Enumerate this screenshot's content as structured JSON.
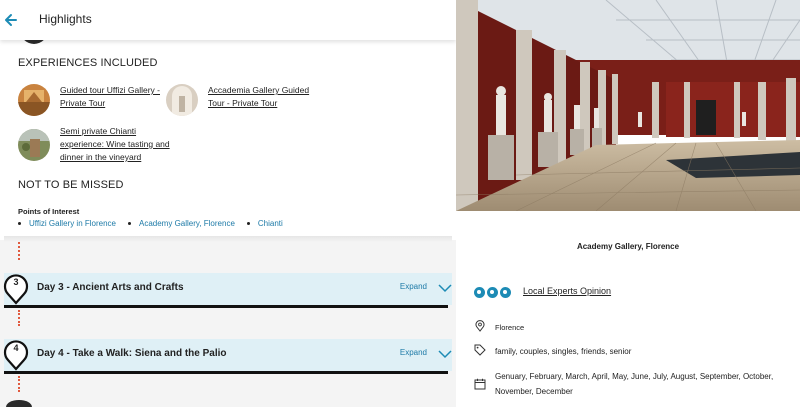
{
  "header": {
    "title": "Highlights"
  },
  "experiences": {
    "heading": "EXPERIENCES INCLUDED",
    "items": [
      {
        "label": "Guided tour Uffizi Gallery - Private Tour"
      },
      {
        "label": "Accademia Gallery Guided Tour - Private Tour"
      },
      {
        "label": "Semi private Chianti experience: Wine tasting and dinner in the vineyard"
      }
    ]
  },
  "not_missed": {
    "heading": "NOT TO BE MISSED"
  },
  "poi": {
    "heading": "Points of Interest",
    "items": [
      "Uffizi Gallery in Florence",
      "Academy Gallery, Florence",
      "Chianti"
    ]
  },
  "days": [
    {
      "number": "3",
      "title": "Day 3 - Ancient Arts and Crafts",
      "expand": "Expand"
    },
    {
      "number": "4",
      "title": "Day 4 - Take a Walk: Siena and the Palio",
      "expand": "Expand"
    }
  ],
  "detail": {
    "title": "Academy Gallery, Florence",
    "rating_label": "Local Experts Opinion",
    "rating_count": 3,
    "location": "Florence",
    "tags": "family, couples, singles, friends, senior",
    "months": "Genuary, February, March, April, May, June, July, August, September, October, November, December"
  },
  "colors": {
    "accent": "#1d7aa7",
    "day_bg": "#dff0f6",
    "dots": "#e05a3f"
  }
}
